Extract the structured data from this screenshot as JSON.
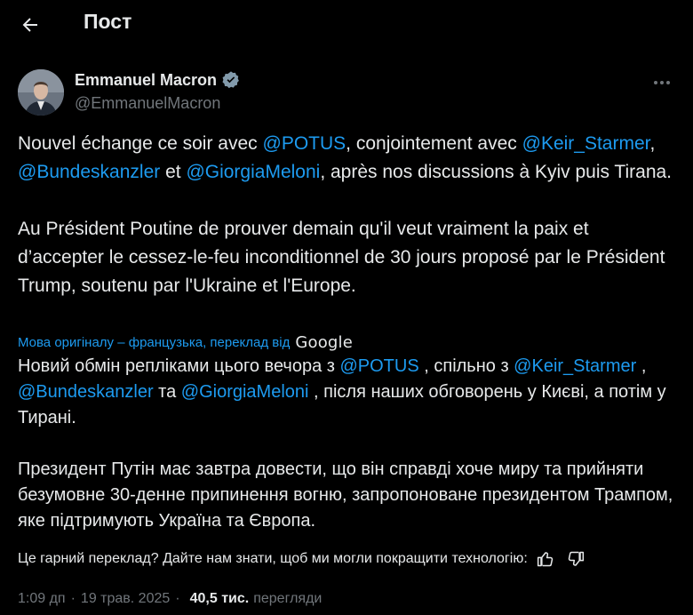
{
  "header": {
    "title": "Пост"
  },
  "author": {
    "name": "Emmanuel Macron",
    "handle": "@EmmanuelMacron"
  },
  "tweet": {
    "original": {
      "p1": [
        {
          "t": "Nouvel échange ce soir avec ",
          "m": false
        },
        {
          "t": "@POTUS",
          "m": true
        },
        {
          "t": ", conjointement avec ",
          "m": false
        },
        {
          "t": "@Keir_Starmer",
          "m": true
        },
        {
          "t": ", ",
          "m": false
        },
        {
          "t": "@Bundeskanzler",
          "m": true
        },
        {
          "t": " et ",
          "m": false
        },
        {
          "t": "@GiorgiaMeloni",
          "m": true
        },
        {
          "t": ", après nos discussions à Kyiv puis Tirana.",
          "m": false
        }
      ],
      "p2": "Au Président Poutine de prouver demain qu'il veut vraiment la paix et d’accepter le cessez-le-feu inconditionnel de 30 jours proposé par le Président Trump, soutenu par l'Ukraine et l'Europe."
    },
    "translation_note": "Мова оригіналу – французька, переклад від",
    "translation_provider": "Google",
    "translated": {
      "p1": [
        {
          "t": "Новий обмін репліками цього вечора з ",
          "m": false
        },
        {
          "t": "@POTUS",
          "m": true
        },
        {
          "t": " , спільно з ",
          "m": false
        },
        {
          "t": "@Keir_Starmer",
          "m": true
        },
        {
          "t": " , ",
          "m": false
        },
        {
          "t": "@Bundeskanzler",
          "m": true
        },
        {
          "t": " та ",
          "m": false
        },
        {
          "t": "@GiorgiaMeloni",
          "m": true
        },
        {
          "t": " , після наших обговорень у Києві, а потім у Тирані.",
          "m": false
        }
      ],
      "p2": "Президент Путін має завтра довести, що він справді хоче миру та прийняти безумовне 30-денне припинення вогню, запропоноване президентом Трампом, яке підтримують Україна та Європа."
    }
  },
  "feedback": {
    "prompt": "Це гарний переклад? Дайте нам знати, щоб ми могли покращити технологію:"
  },
  "meta": {
    "time": "1:09 дп",
    "date": "19 трав. 2025",
    "views_count": "40,5 тис.",
    "views_label": "перегляди"
  },
  "colors": {
    "background": "#000000",
    "text": "#e7e9ea",
    "muted": "#71767b",
    "accent": "#1d9bf0"
  }
}
